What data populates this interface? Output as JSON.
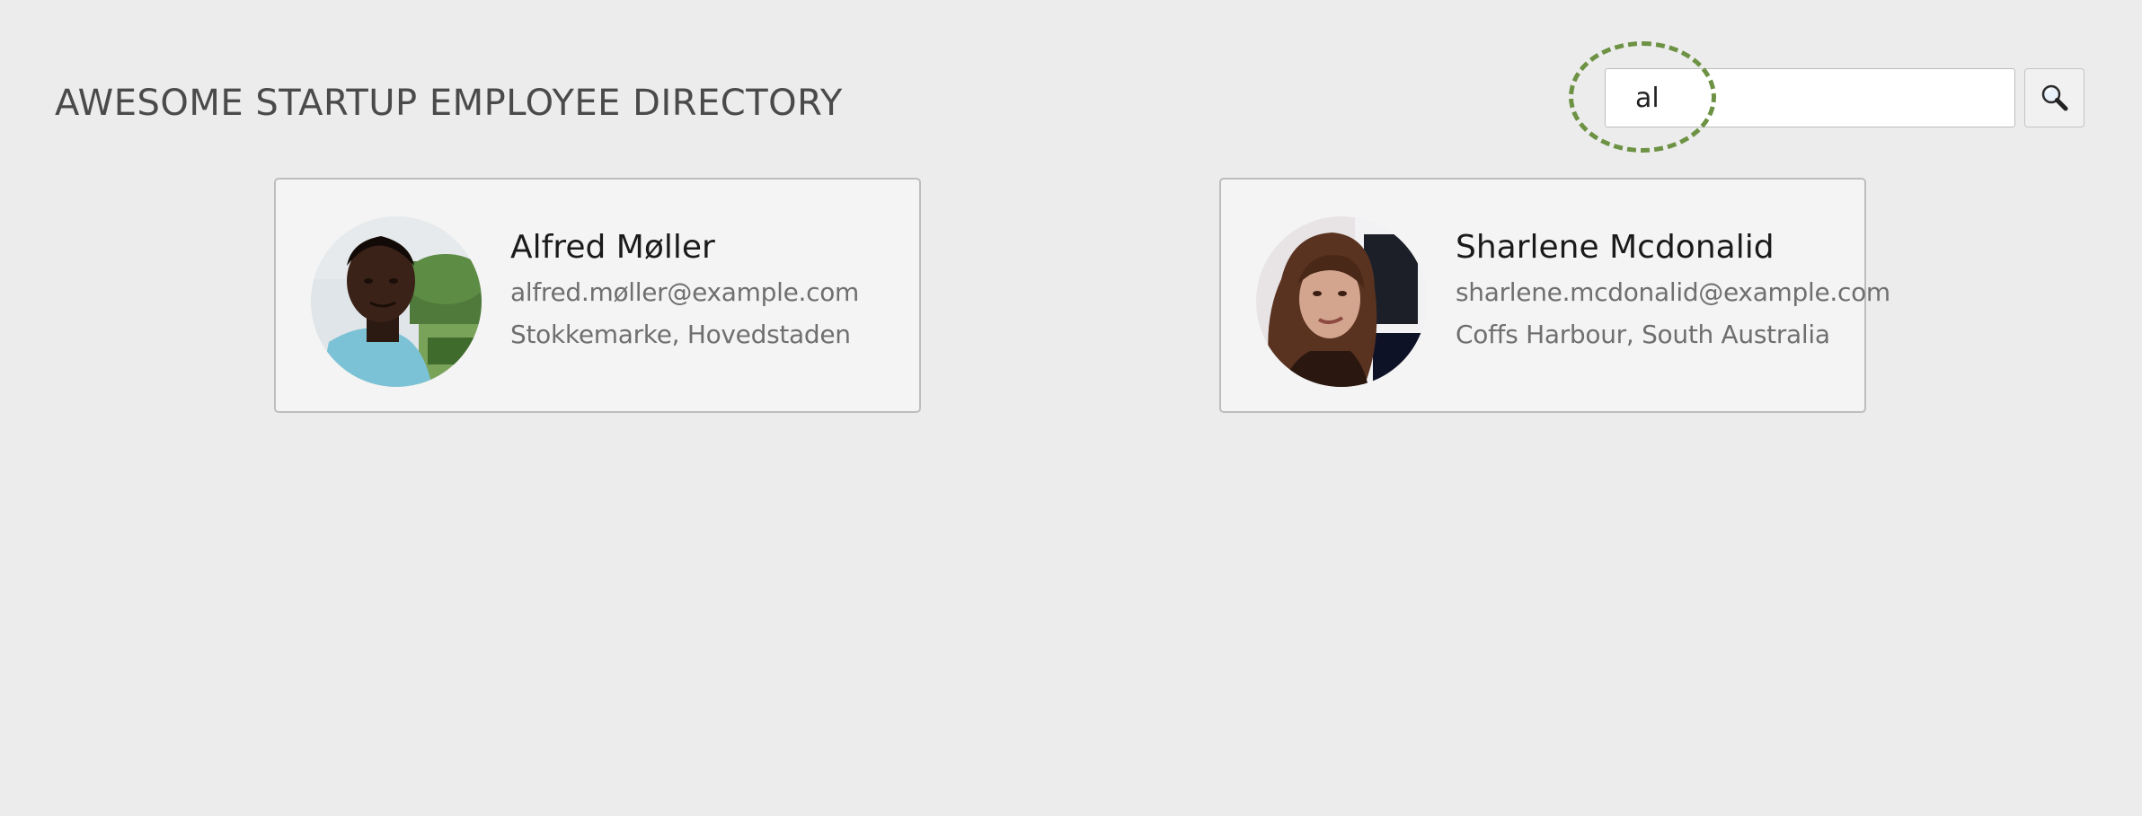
{
  "header": {
    "title": "AWESOME STARTUP EMPLOYEE DIRECTORY"
  },
  "search": {
    "value": "al",
    "placeholder": "",
    "button_icon": "search-icon"
  },
  "highlight": {
    "color": "#6d9244"
  },
  "employees": [
    {
      "name": "Alfred Møller",
      "email": "alfred.møller@example.com",
      "location": "Stokkemarke, Hovedstaden"
    },
    {
      "name": "Sharlene Mcdonalid",
      "email": "sharlene.mcdonalid@example.com",
      "location": "Coffs Harbour, South Australia"
    }
  ]
}
